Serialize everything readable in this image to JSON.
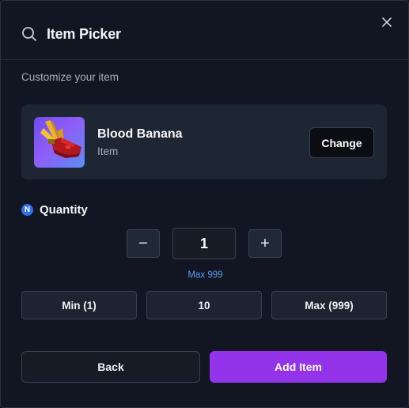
{
  "header": {
    "title": "Item Picker",
    "icon": "search-icon",
    "close_icon": "close-icon"
  },
  "subtitle": "Customize your item",
  "item": {
    "name": "Blood Banana",
    "type": "Item",
    "change_label": "Change",
    "thumbnail_icon": "blood-banana-icon"
  },
  "quantity": {
    "badge": "N",
    "label": "Quantity",
    "decrement_label": "−",
    "increment_label": "+",
    "value": "1",
    "max_hint": "Max 999"
  },
  "presets": [
    {
      "label": "Min (1)"
    },
    {
      "label": "10"
    },
    {
      "label": "Max (999)"
    }
  ],
  "footer": {
    "back_label": "Back",
    "add_label": "Add Item"
  },
  "colors": {
    "accent": "#9333ea",
    "hint": "#5b9ff5",
    "badge": "#2f6ff0",
    "panel": "#111622",
    "card": "#1e2533"
  }
}
